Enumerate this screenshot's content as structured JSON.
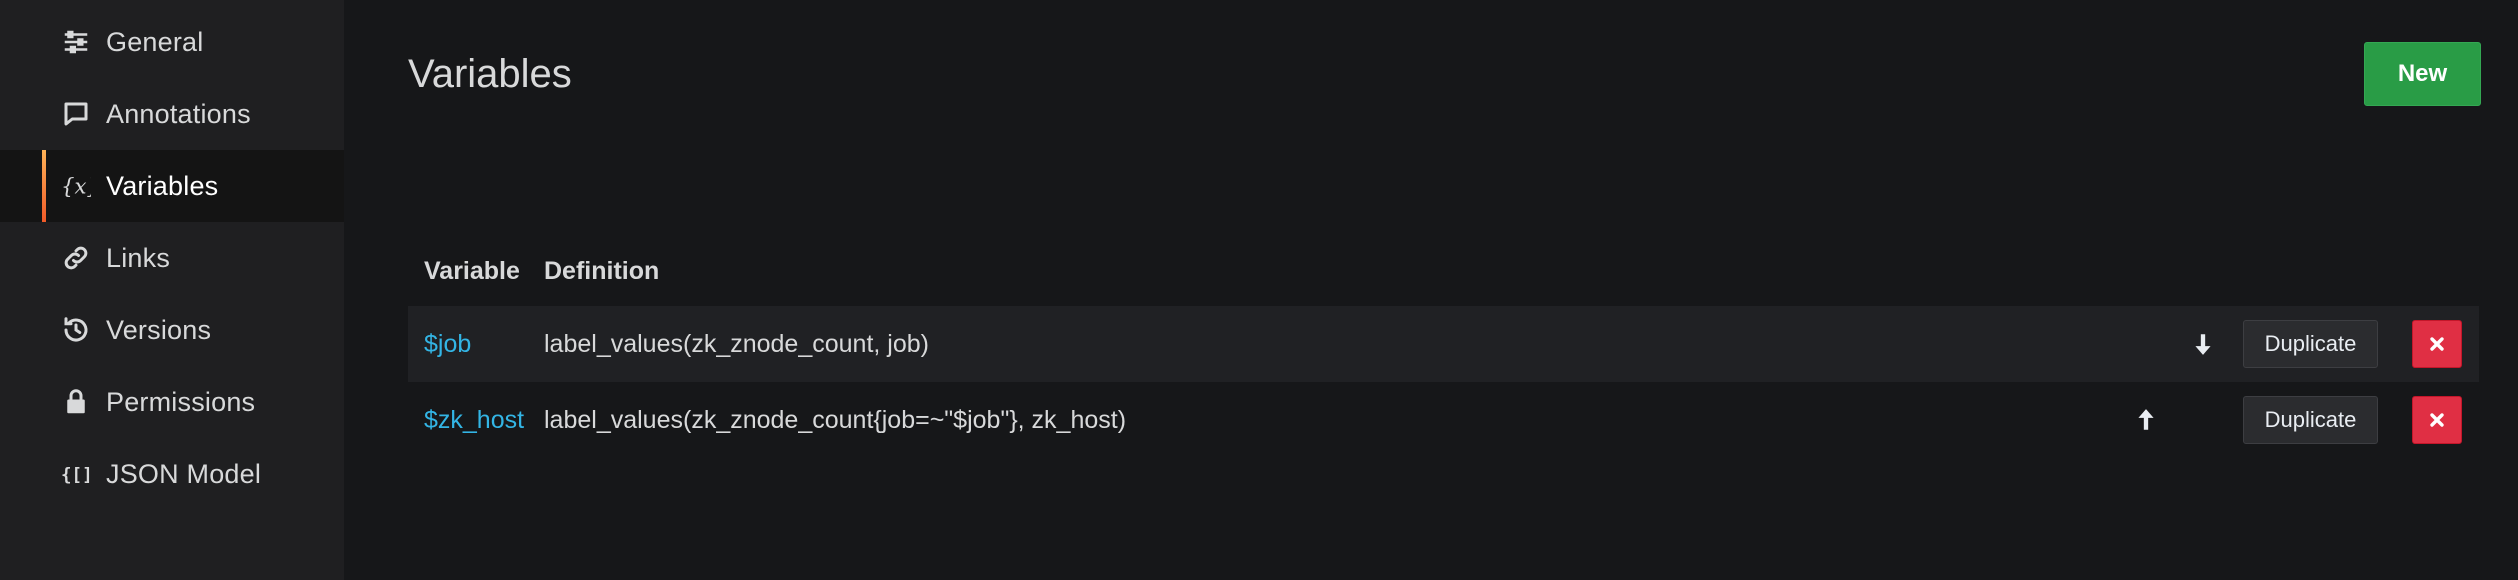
{
  "sidebar": {
    "items": [
      {
        "label": "General",
        "icon": "sliders-icon",
        "active": false
      },
      {
        "label": "Annotations",
        "icon": "comment-icon",
        "active": false
      },
      {
        "label": "Variables",
        "icon": "variable-icon",
        "active": true
      },
      {
        "label": "Links",
        "icon": "link-icon",
        "active": false
      },
      {
        "label": "Versions",
        "icon": "history-icon",
        "active": false
      },
      {
        "label": "Permissions",
        "icon": "lock-icon",
        "active": false
      },
      {
        "label": "JSON Model",
        "icon": "json-icon",
        "active": false
      }
    ]
  },
  "main": {
    "title": "Variables",
    "new_button": "New",
    "table": {
      "headers": {
        "variable": "Variable",
        "definition": "Definition"
      },
      "rows": [
        {
          "variable": "$job",
          "definition": "label_values(zk_znode_count, job)",
          "move": "down",
          "duplicate_label": "Duplicate"
        },
        {
          "variable": "$zk_host",
          "definition": "label_values(zk_znode_count{job=~\"$job\"}, zk_host)",
          "move": "up",
          "duplicate_label": "Duplicate"
        }
      ]
    }
  },
  "colors": {
    "background": "#161719",
    "sidebar": "#1f1f21",
    "link": "#33b5e5",
    "primary": "#299c46",
    "danger": "#e02f44",
    "active_accent": "#f05a28"
  }
}
